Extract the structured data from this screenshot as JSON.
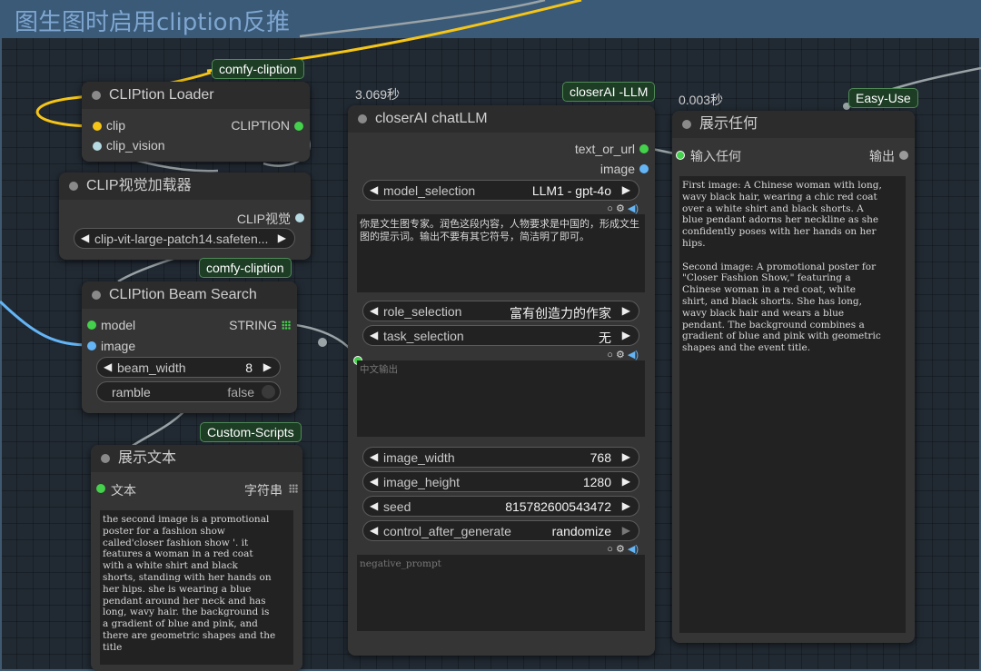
{
  "group": {
    "title": "图生图时启用cliption反推"
  },
  "colors": {
    "clip_wire": "#f5c518",
    "image_wire": "#64b5f6",
    "node_bg": "#353535",
    "badge_bg": "#1d3d25"
  },
  "loader": {
    "badge": "comfy-cliption",
    "title": "CLIPtion Loader",
    "inputs": [
      "clip",
      "clip_vision"
    ],
    "output": "CLIPTION"
  },
  "clipvision": {
    "title": "CLIP视觉加载器",
    "output": "CLIP视觉",
    "model": "clip-vit-large-patch14.safeten..."
  },
  "beam": {
    "badge": "comfy-cliption",
    "title": "CLIPtion Beam Search",
    "inputs": [
      "model",
      "image"
    ],
    "output": "STRING",
    "beam_width": {
      "label": "beam_width",
      "value": "8"
    },
    "ramble": {
      "label": "ramble",
      "value": "false"
    }
  },
  "show": {
    "badge": "Custom-Scripts",
    "title": "展示文本",
    "input": "文本",
    "output": "字符串",
    "text": "the second image is a promotional\nposter for a fashion show\ncalled'closer fashion show '. it\nfeatures a woman in a red coat\nwith a white shirt and black\nshorts, standing with her hands on\nher hips. she is wearing a blue\npendant around her neck and has\nlong, wavy hair. the background is\na gradient of blue and pink, and\nthere are geometric shapes and the\ntitle"
  },
  "llm": {
    "timing": "3.069秒",
    "badge": "closerAI -LLM",
    "title": "closerAI chatLLM",
    "inputs": [
      "text_or_url",
      "image"
    ],
    "model_selection": {
      "label": "model_selection",
      "value": "LLM1 - gpt-4o"
    },
    "system_prompt": "你是文生图专家。润色这段内容，人物要求是中国的，形成文生图的提示词。输出不要有其它符号，简洁明了即可。",
    "role_selection": {
      "label": "role_selection",
      "value": "富有创造力的作家"
    },
    "task_selection": {
      "label": "task_selection",
      "value": "无"
    },
    "prompt_placeholder": "中文输出",
    "image_width": {
      "label": "image_width",
      "value": "768"
    },
    "image_height": {
      "label": "image_height",
      "value": "1280"
    },
    "seed": {
      "label": "seed",
      "value": "815782600543472"
    },
    "control_after_generate": {
      "label": "control_after_generate",
      "value": "randomize"
    },
    "negative_placeholder": "negative_prompt"
  },
  "display": {
    "timing": "0.003秒",
    "badge": "Easy-Use",
    "title": "展示任何",
    "input": "输入任何",
    "output": "输出",
    "text": "First image: A Chinese woman with long,\nwavy black hair, wearing a chic red coat\nover a white shirt and black shorts. A\nblue pendant adorns her neckline as she\nconfidently poses with her hands on her\nhips.\n\nSecond image: A promotional poster for\n\"Closer Fashion Show,\" featuring a\nChinese woman in a red coat, white\nshirt, and black shorts. She has long,\nwavy black hair and wears a blue\npendant. The background combines a\ngradient of blue and pink with geometric\nshapes and the event title."
  },
  "widget_icons": {
    "toggle": "circle-icon",
    "gear": "gear-icon",
    "speaker": "speaker-icon"
  }
}
